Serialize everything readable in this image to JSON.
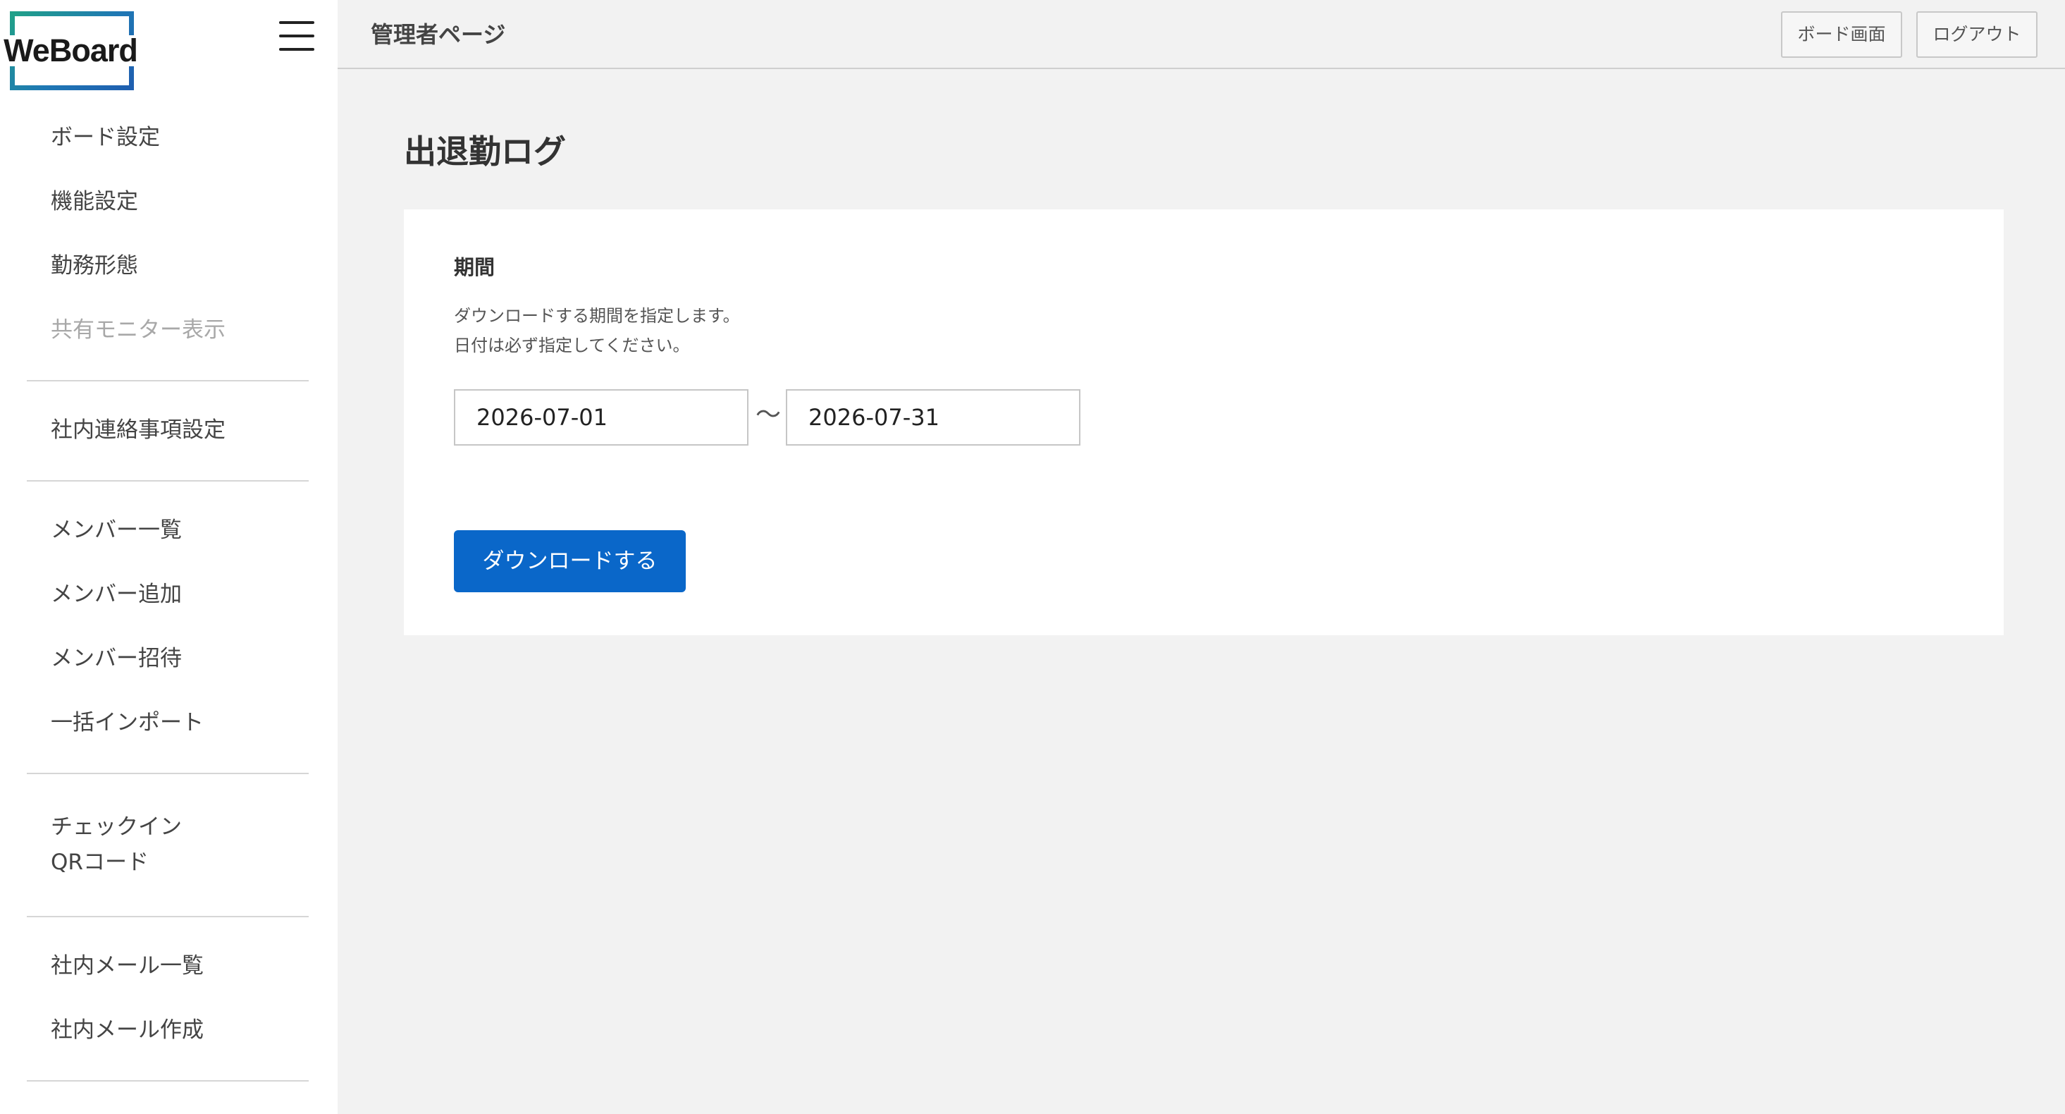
{
  "brand": {
    "logo_text": "WeBoard",
    "accent": "#0a67c9"
  },
  "sidebar": {
    "groups": [
      {
        "items": [
          {
            "label": "ボード設定",
            "disabled": false
          },
          {
            "label": "機能設定",
            "disabled": false
          },
          {
            "label": "勤務形態",
            "disabled": false
          },
          {
            "label": "共有モニター表示",
            "disabled": true
          }
        ]
      },
      {
        "items": [
          {
            "label": "社内連絡事項設定",
            "disabled": false
          }
        ]
      },
      {
        "items": [
          {
            "label": "メンバー一覧",
            "disabled": false
          },
          {
            "label": "メンバー追加",
            "disabled": false
          },
          {
            "label": "メンバー招待",
            "disabled": false
          },
          {
            "label": "一括インポート",
            "disabled": false
          }
        ]
      },
      {
        "items": [
          {
            "label_line1": "チェックイン",
            "label_line2": "QRコード",
            "disabled": false
          }
        ]
      },
      {
        "items": [
          {
            "label": "社内メール一覧",
            "disabled": false
          },
          {
            "label": "社内メール作成",
            "disabled": false
          }
        ]
      }
    ]
  },
  "header": {
    "title": "管理者ページ",
    "board_button": "ボード画面",
    "logout_button": "ログアウト"
  },
  "main": {
    "title": "出退勤ログ",
    "period": {
      "label": "期間",
      "desc_line1": "ダウンロードする期間を指定します。",
      "desc_line2": "日付は必ず指定してください。",
      "from": "2026-07-01",
      "separator": "〜",
      "to": "2026-07-31"
    },
    "download_button": "ダウンロードする"
  }
}
